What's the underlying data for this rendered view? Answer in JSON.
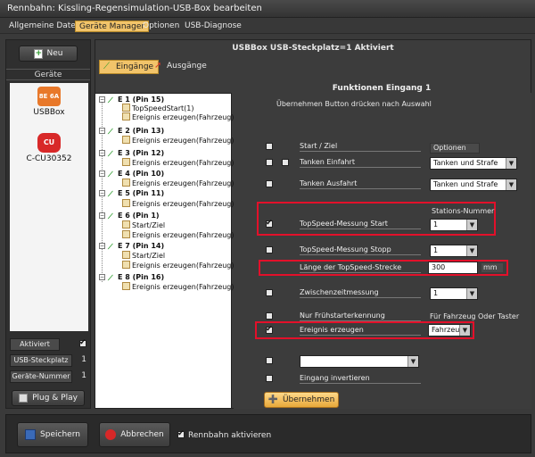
{
  "window": {
    "title": "Rennbahn: Kissling-Regensimulation-USB-Box bearbeiten"
  },
  "menu": [
    "Allgemeine Daten",
    "Geräte Manager",
    "Optionen",
    "USB-Diagnose"
  ],
  "left": {
    "new_label": "Neu",
    "devices_header": "Geräte",
    "devices": [
      {
        "badge": "8E 6A",
        "name": "USBBox"
      },
      {
        "name": "C-CU30352",
        "badge": "CU"
      }
    ],
    "active_label": "Aktiviert",
    "usb_slot_label": "USB-Steckplatz",
    "usb_slot_value": "1",
    "device_number_label": "Geräte-Nummer",
    "device_number_value": "1",
    "plug_play_label": "Plug & Play"
  },
  "main": {
    "header": "USBBox  USB-Steckplatz=1  Aktiviert",
    "tab_inputs": "Eingänge",
    "tab_outputs": "Ausgänge",
    "section_title": "Funktionen Eingang 1",
    "hint": "Übernehmen Button drücken nach Auswahl",
    "options_label": "Optionen",
    "station_label": "Stations-Nummer",
    "any_label": "Für Fahrzeug Oder Taster",
    "mm_label": "mm",
    "apply_label": "Übernehmen"
  },
  "tree": [
    {
      "label": "E 1 (Pin 15)",
      "children": [
        "TopSpeedStart(1)",
        "Ereignis erzeugen(Fahrzeug)"
      ]
    },
    {
      "label": "E 2 (Pin 13)",
      "children": [
        "Ereignis erzeugen(Fahrzeug)"
      ]
    },
    {
      "label": "E 3 (Pin 12)",
      "children": [
        "Ereignis erzeugen(Fahrzeug)"
      ]
    },
    {
      "label": "E 4 (Pin 10)",
      "children": [
        "Ereignis erzeugen(Fahrzeug)"
      ]
    },
    {
      "label": "E 5 (Pin 11)",
      "children": [
        "Ereignis erzeugen(Fahrzeug)"
      ]
    },
    {
      "label": "E 6 (Pin 1)",
      "children": [
        "Start/Ziel",
        "Ereignis erzeugen(Fahrzeug)"
      ]
    },
    {
      "label": "E 7 (Pin 14)",
      "children": [
        "Start/Ziel",
        "Ereignis erzeugen(Fahrzeug)"
      ]
    },
    {
      "label": "E 8 (Pin 16)",
      "children": [
        "Ereignis erzeugen(Fahrzeug)"
      ]
    }
  ],
  "functions": {
    "start_ziel": "Start / Ziel",
    "tanken_einfahrt": "Tanken Einfahrt",
    "tanken_einfahrt_option": "Tanken und Strafe",
    "tanken_ausfahrt": "Tanken Ausfahrt",
    "tanken_ausfahrt_option": "Tanken und Strafe",
    "topspeed_start": "TopSpeed-Messung Start",
    "topspeed_start_value": "1",
    "topspeed_stopp": "TopSpeed-Messung Stopp",
    "topspeed_stopp_value": "1",
    "laenge": "Länge der TopSpeed-Strecke",
    "laenge_value": "300",
    "zwischenzeit": "Zwischenzeitmessung",
    "zwischenzeit_value": "1",
    "fruehstart": "Nur Frühstarterkennung",
    "ereignis": "Ereignis erzeugen",
    "ereignis_value": "Fahrzeug",
    "eingang_invertieren": "Eingang invertieren",
    "empty_dropdown": ""
  },
  "bottom": {
    "save_label": "Speichern",
    "cancel_label": "Abbrechen",
    "activate_label": "Rennbahn aktivieren"
  },
  "colors": {
    "highlight": "#f2c46a",
    "red_box": "#e3102a",
    "plug_green": "#2a9b2a"
  }
}
